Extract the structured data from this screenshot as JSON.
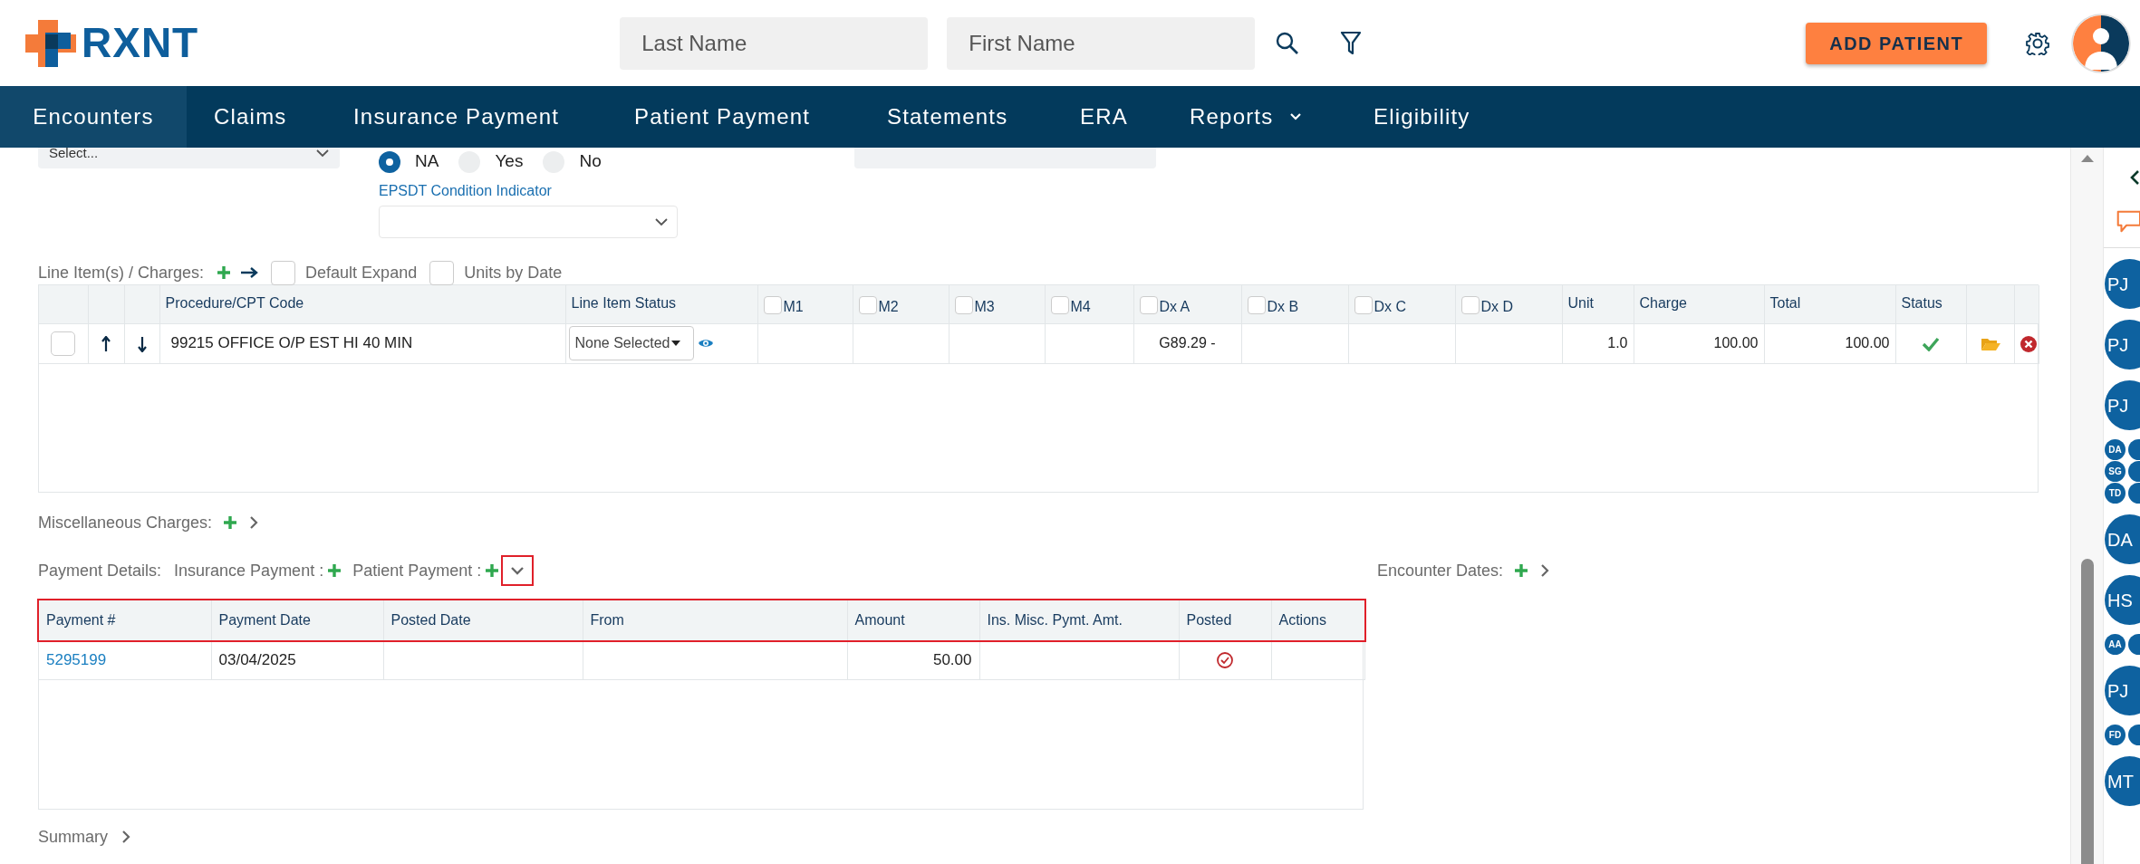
{
  "header": {
    "logo": "RXNT",
    "last_name": {
      "placeholder": "Last Name"
    },
    "first_name": {
      "placeholder": "First Name"
    },
    "add_patient": "ADD PATIENT"
  },
  "nav": [
    {
      "label": "Encounters",
      "selected": true,
      "has_menu": false
    },
    {
      "label": "Claims",
      "selected": false,
      "has_menu": false
    },
    {
      "label": "Insurance Payment",
      "selected": false,
      "has_menu": false
    },
    {
      "label": "Patient Payment",
      "selected": false,
      "has_menu": false
    },
    {
      "label": "Statements",
      "selected": false,
      "has_menu": false
    },
    {
      "label": "ERA",
      "selected": false,
      "has_menu": false
    },
    {
      "label": "Reports",
      "selected": false,
      "has_menu": true
    },
    {
      "label": "Eligibility",
      "selected": false,
      "has_menu": false
    }
  ],
  "form": {
    "select": {
      "value": "Select..."
    },
    "radios": [
      {
        "label": "NA",
        "selected": true
      },
      {
        "label": "Yes",
        "selected": false
      },
      {
        "label": "No",
        "selected": false
      }
    ],
    "epsdt_label": "EPSDT Condition Indicator"
  },
  "line_items": {
    "label": "Line Item(s) / Charges:",
    "options": [
      {
        "label": "Default Expand",
        "checked": false
      },
      {
        "label": "Units by Date",
        "checked": false
      }
    ],
    "columns": [
      {
        "kind": "blank"
      },
      {
        "kind": "blank"
      },
      {
        "kind": "blank"
      },
      {
        "kind": "text",
        "label": "Procedure/CPT Code"
      },
      {
        "kind": "text",
        "label": "Line Item Status"
      },
      {
        "kind": "check",
        "label": "M1",
        "checked": false
      },
      {
        "kind": "check",
        "label": "M2",
        "checked": false
      },
      {
        "kind": "check",
        "label": "M3",
        "checked": false
      },
      {
        "kind": "check",
        "label": "M4",
        "checked": false
      },
      {
        "kind": "check",
        "label": "Dx A",
        "checked": false
      },
      {
        "kind": "check",
        "label": "Dx B",
        "checked": false
      },
      {
        "kind": "check",
        "label": "Dx C",
        "checked": false
      },
      {
        "kind": "check",
        "label": "Dx D",
        "checked": false
      },
      {
        "kind": "text",
        "label": "Unit"
      },
      {
        "kind": "text",
        "label": "Charge"
      },
      {
        "kind": "text",
        "label": "Total"
      },
      {
        "kind": "text",
        "label": "Status"
      },
      {
        "kind": "blank"
      },
      {
        "kind": "blank"
      }
    ],
    "rows": [
      {
        "cells": [
          {
            "kind": "checkbox",
            "checked": false
          },
          {
            "kind": "up"
          },
          {
            "kind": "down"
          },
          {
            "kind": "text",
            "text": "99215 OFFICE O/P EST HI 40 MIN"
          },
          {
            "kind": "status_select",
            "value": "None Selected"
          },
          {
            "kind": "empty"
          },
          {
            "kind": "empty"
          },
          {
            "kind": "empty"
          },
          {
            "kind": "empty"
          },
          {
            "kind": "center",
            "text": "G89.29 -"
          },
          {
            "kind": "empty"
          },
          {
            "kind": "empty"
          },
          {
            "kind": "empty"
          },
          {
            "kind": "number",
            "text": "1.0"
          },
          {
            "kind": "number",
            "text": "100.00"
          },
          {
            "kind": "number",
            "text": "100.00"
          },
          {
            "kind": "ok"
          },
          {
            "kind": "attach"
          },
          {
            "kind": "remove"
          }
        ]
      }
    ]
  },
  "misc_charges": {
    "label": "Miscellaneous Charges:"
  },
  "payment": {
    "label": "Payment Details:",
    "insurance": "Insurance Payment :",
    "patient": "Patient Payment :",
    "collapse_highlighted": true,
    "header_highlighted": true,
    "columns": [
      "Payment #",
      "Payment Date",
      "Posted Date",
      "From",
      "Amount",
      "Ins. Misc. Pymt. Amt.",
      "Posted",
      "Actions"
    ],
    "rows": [
      {
        "payment_no": "5295199",
        "payment_date": "03/04/2025",
        "amount": "50.00",
        "posted": true
      }
    ]
  },
  "encounter_dates": {
    "label": "Encounter Dates:"
  },
  "summary": {
    "label": "Summary"
  },
  "sidebar": {
    "avatars": [
      {
        "kind": "large",
        "initials": "PJ"
      },
      {
        "kind": "large",
        "initials": "PJ"
      },
      {
        "kind": "large",
        "initials": "PJ"
      },
      {
        "kind": "small",
        "initials": [
          "DA",
          "SG",
          "TD"
        ]
      },
      {
        "kind": "large",
        "initials": "DA"
      },
      {
        "kind": "large",
        "initials": "HS"
      },
      {
        "kind": "small",
        "initials": [
          "AA"
        ]
      },
      {
        "kind": "large",
        "initials": "PJ"
      },
      {
        "kind": "small",
        "initials": [
          "FD"
        ]
      },
      {
        "kind": "large",
        "initials": "MT"
      }
    ]
  }
}
